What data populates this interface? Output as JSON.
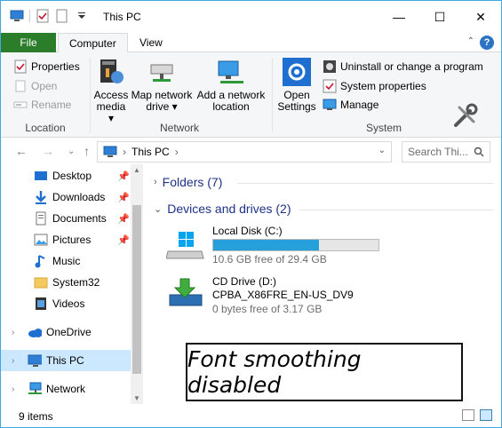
{
  "window": {
    "title": "This PC",
    "minimize_glyph": "—",
    "maximize_glyph": "☐",
    "close_glyph": "✕"
  },
  "ribbon_tabs": {
    "file": "File",
    "computer": "Computer",
    "view": "View"
  },
  "help_glyph": "?",
  "ribbon": {
    "location": {
      "label": "Location",
      "properties": "Properties",
      "open": "Open",
      "rename": "Rename"
    },
    "network": {
      "label": "Network",
      "access_media": [
        "Access",
        "media ▾"
      ],
      "map_network_drive": [
        "Map network",
        "drive ▾"
      ],
      "add_network_location": [
        "Add a network",
        "location"
      ]
    },
    "system": {
      "label": "System",
      "open_settings": [
        "Open",
        "Settings"
      ],
      "uninstall": "Uninstall or change a program",
      "system_properties": "System properties",
      "manage": "Manage"
    }
  },
  "address": {
    "path_item": "This PC",
    "separator": "›",
    "search_placeholder": "Search Thi..."
  },
  "nav": [
    {
      "label": "Desktop",
      "pinned": true
    },
    {
      "label": "Downloads",
      "pinned": true
    },
    {
      "label": "Documents",
      "pinned": true
    },
    {
      "label": "Pictures",
      "pinned": true
    },
    {
      "label": "Music",
      "pinned": false
    },
    {
      "label": "System32",
      "pinned": false
    },
    {
      "label": "Videos",
      "pinned": false
    },
    {
      "label": "OneDrive",
      "pinned": false
    },
    {
      "label": "This PC",
      "pinned": false,
      "selected": true
    },
    {
      "label": "Network",
      "pinned": false
    }
  ],
  "content": {
    "folders_header": "Folders (7)",
    "devices_header": "Devices and drives (2)",
    "drives": [
      {
        "name": "Local Disk (C:)",
        "free_text": "10.6 GB free of 29.4 GB",
        "used_fraction": 0.64
      },
      {
        "name": "CD Drive (D:)",
        "label": "CPBA_X86FRE_EN-US_DV9",
        "free_text": "0 bytes free of 3.17 GB"
      }
    ]
  },
  "status": {
    "items": "9 items"
  },
  "caption": "Font smoothing disabled",
  "colors": {
    "file_tab": "#2b7d2a",
    "accent": "#26a0da",
    "selected_nav": "#cce8ff",
    "header_text": "#1e3287"
  }
}
